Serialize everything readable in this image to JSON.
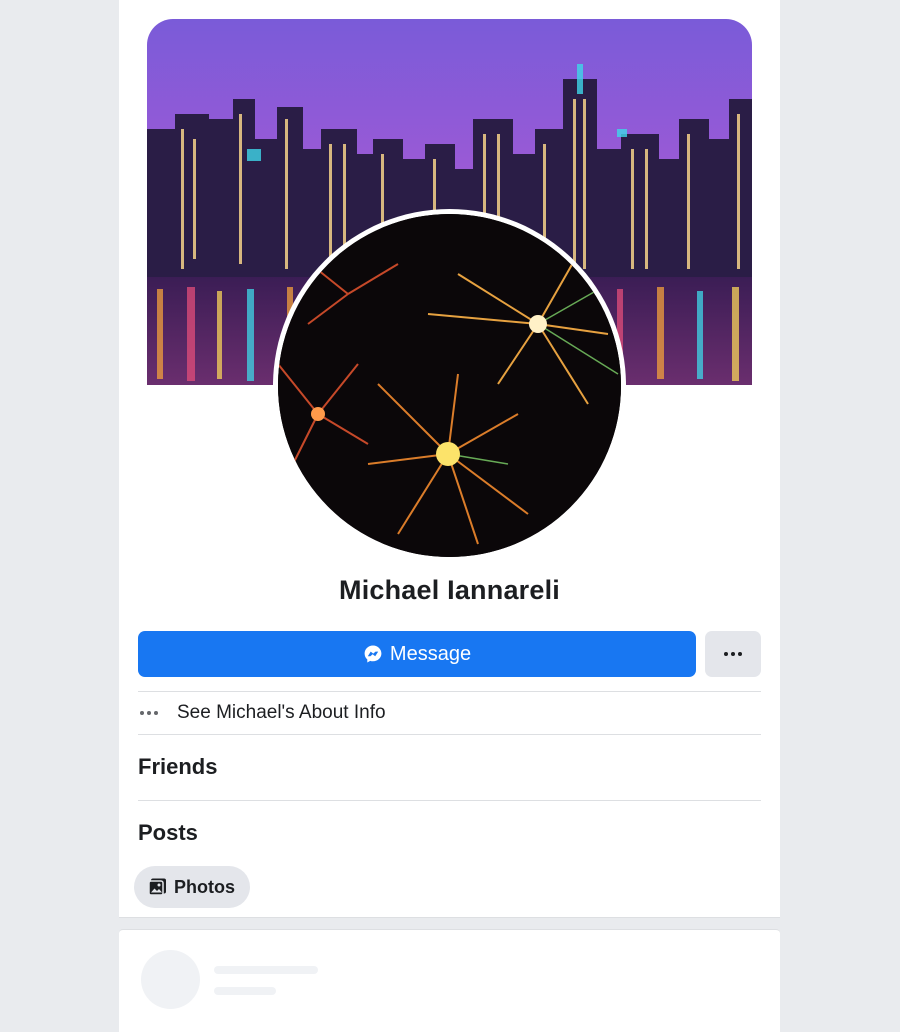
{
  "profile": {
    "name": "Michael Iannareli"
  },
  "actions": {
    "message_label": "Message"
  },
  "about": {
    "label": "See Michael's About Info"
  },
  "sections": {
    "friends_title": "Friends",
    "posts_title": "Posts"
  },
  "filters": {
    "photos_label": "Photos"
  },
  "colors": {
    "accent": "#1877f2",
    "secondary_button": "#e4e6eb",
    "page_background": "#e9ebee"
  },
  "icons": {
    "message": "messenger-icon",
    "more": "more-options-icon",
    "about": "more-dots-icon",
    "photos": "photos-icon"
  }
}
